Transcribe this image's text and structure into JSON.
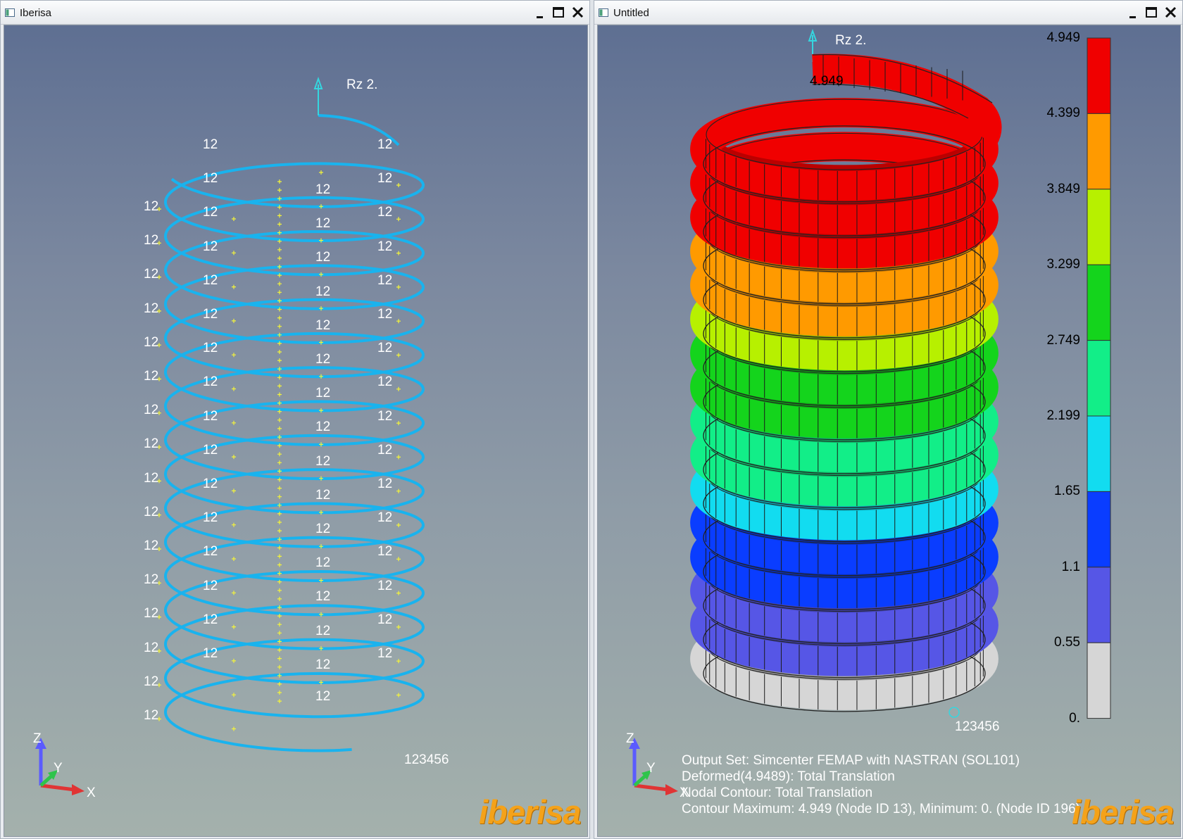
{
  "left_window": {
    "title": "Iberisa",
    "view": {
      "rz_label": "Rz 2.",
      "node_label": "12",
      "constraint_label": "123456",
      "axes": {
        "z": "Z",
        "y": "Y",
        "x": "X"
      },
      "logo": "iberisa"
    }
  },
  "right_window": {
    "title": "Untitled",
    "view": {
      "rz_label": "Rz 2.",
      "max_tag": "4.949",
      "constraint_label": "123456",
      "axes": {
        "z": "Z",
        "y": "Y",
        "x": "X"
      },
      "logo": "iberisa",
      "legend": {
        "values": [
          "4.949",
          "4.399",
          "3.849",
          "3.299",
          "2.749",
          "2.199",
          "1.65",
          "1.1",
          "0.55",
          "0."
        ],
        "colors": [
          "#f00000",
          "#ff9a00",
          "#b7f000",
          "#14d41c",
          "#12ee88",
          "#12dcf0",
          "#0a3dff",
          "#5656e6",
          "#d6d6d6"
        ]
      },
      "info": {
        "line1": "Output Set: Simcenter FEMAP with NASTRAN (SOL101)",
        "line2": "Deformed(4.9489): Total Translation",
        "line3": "Nodal Contour: Total Translation",
        "line4": "Contour Maximum: 4.949 (Node ID 13), Minimum: 0. (Node ID 196)"
      },
      "spring_bands": [
        "#f00000",
        "#f00000",
        "#f00000",
        "#ff9a00",
        "#ff9a00",
        "#b7f000",
        "#14d41c",
        "#14d41c",
        "#12ee88",
        "#12ee88",
        "#12dcf0",
        "#0a3dff",
        "#0a3dff",
        "#5656e6",
        "#5656e6",
        "#d6d6d6"
      ]
    }
  },
  "window_controls": {
    "minimize_icon": "minimize-icon",
    "maximize_icon": "maximize-icon",
    "close_icon": "close-icon"
  }
}
